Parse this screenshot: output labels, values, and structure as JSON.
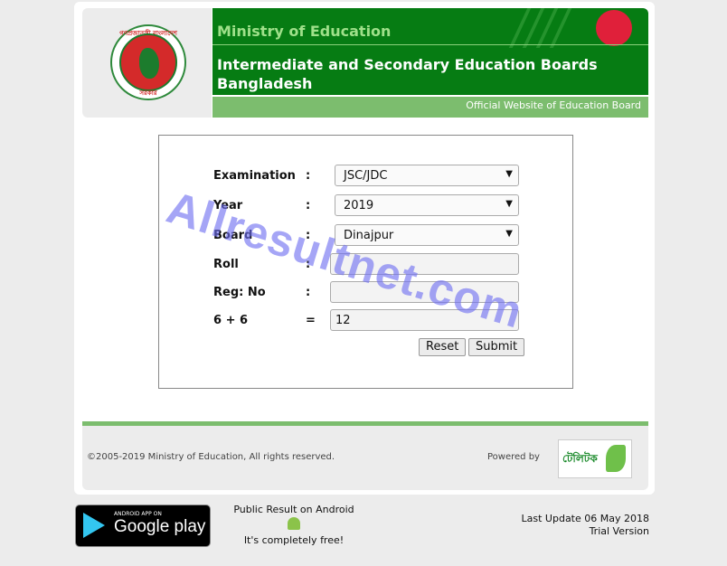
{
  "header": {
    "ministry": "Ministry of Education",
    "boards_line1": "Intermediate and Secondary Education Boards",
    "boards_line2": "Bangladesh",
    "official": "Official Website of Education Board",
    "seal_text_top": "গণপ্রজাতন্ত্রী বাংলাদেশ",
    "seal_text_bottom": "সরকার"
  },
  "form": {
    "examination_label": "Examination",
    "year_label": "Year",
    "board_label": "Board",
    "roll_label": "Roll",
    "reg_label": "Reg: No",
    "captcha_label": "6 + 6",
    "colon": ":",
    "equals": "=",
    "examination_value": "JSC/JDC",
    "year_value": "2019",
    "board_value": "Dinajpur",
    "roll_value": "",
    "reg_value": "",
    "captcha_value": "12",
    "reset_label": "Reset",
    "submit_label": "Submit"
  },
  "watermark": "Allresultnet.com",
  "footer": {
    "copyright": "©2005-2019 Ministry of Education, All rights reserved.",
    "powered_by": "Powered by",
    "teletalk": "টেলিটক"
  },
  "bottom": {
    "gplay_small": "ANDROID APP ON",
    "gplay_big": "Google play",
    "android_line1": "Public Result on Android",
    "android_line2": "It's completely free!",
    "last_update": "Last Update 06 May 2018",
    "trial": "Trial Version"
  },
  "colors": {
    "header_green": "#067c13",
    "light_green": "#7cbd6e",
    "ministry_text": "#9fe08a"
  }
}
